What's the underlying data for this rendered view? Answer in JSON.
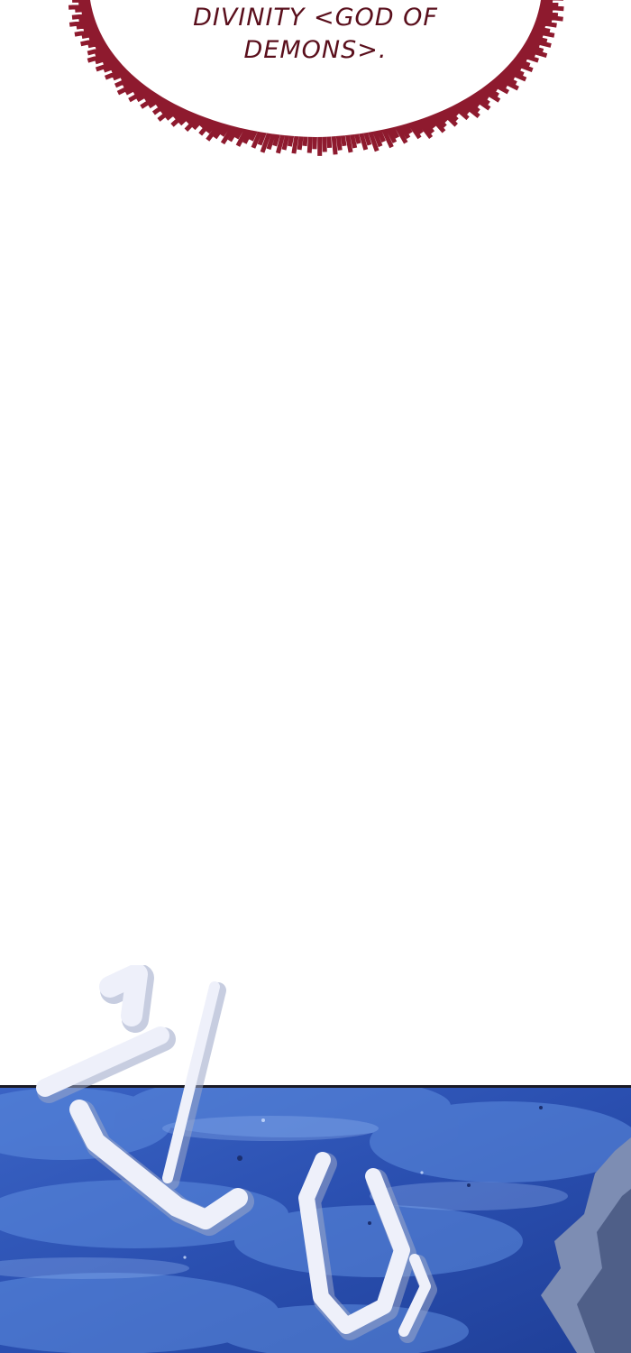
{
  "speech_bubble": {
    "lines": [
      "DIVINITY <GOD OF",
      "DEMONS>."
    ],
    "text_color": "#5a0f1c",
    "fringe_color": "#8e1a2e"
  },
  "night_panel": {
    "sky_color": "#2c53b6",
    "cloud_color": "#5f8ee0",
    "sfx": "휘 익",
    "sfx_color": "#eef0fa"
  }
}
